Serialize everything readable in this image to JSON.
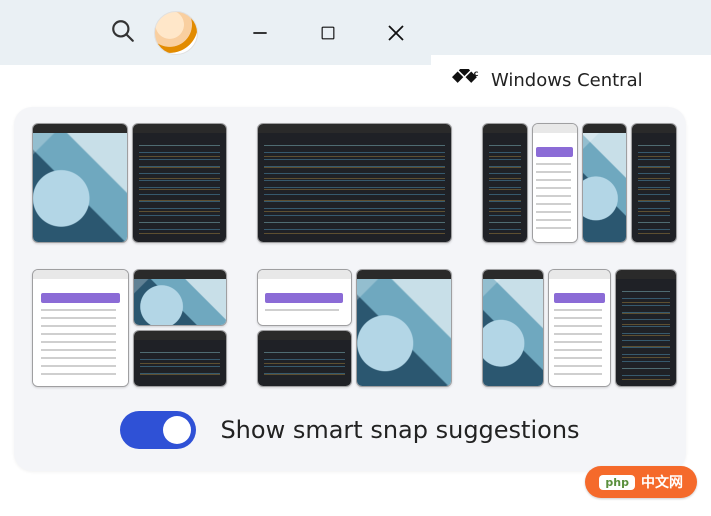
{
  "titlebar": {
    "min_label": "Minimize",
    "max_label": "Maximize",
    "close_label": "Close"
  },
  "brand": {
    "text": "Windows Central"
  },
  "flyout": {
    "toggle_label": "Show smart snap suggestions",
    "toggle_on": true,
    "layouts": [
      {
        "id": "layout-50-50",
        "panes": [
          "photo",
          "code"
        ]
      },
      {
        "id": "layout-full",
        "panes": [
          "code"
        ]
      },
      {
        "id": "layout-25-25-25-25",
        "panes": [
          "code",
          "page",
          "photo",
          "code"
        ]
      },
      {
        "id": "layout-50l-25-25",
        "panes": [
          "page",
          "photo",
          "code"
        ]
      },
      {
        "id": "layout-25-25-50r",
        "panes": [
          "page",
          "photo",
          "code"
        ]
      },
      {
        "id": "layout-33-33-33",
        "panes": [
          "photo",
          "page",
          "code"
        ]
      }
    ]
  },
  "watermark": {
    "brand": "php",
    "suffix": "中文网"
  }
}
